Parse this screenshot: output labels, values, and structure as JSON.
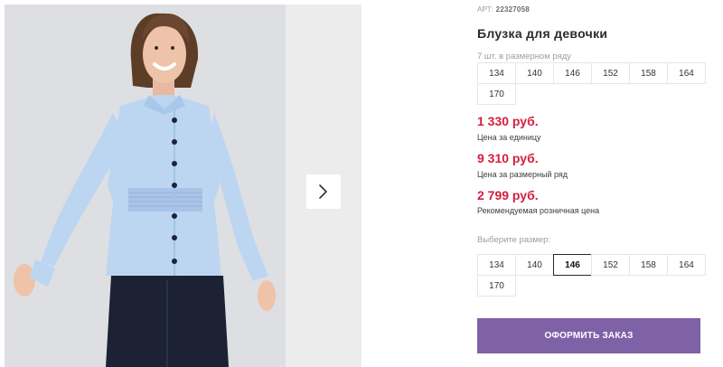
{
  "product": {
    "article_label": "АРТ:",
    "article_number": "22327058",
    "title": "Блузка для девочки",
    "photo_icon": "product-photo",
    "next_icon": "chevron-right-icon"
  },
  "size_row": {
    "label": "7 шт. в размерном ряду",
    "sizes": [
      "134",
      "140",
      "146",
      "152",
      "158",
      "164",
      "170"
    ]
  },
  "prices": [
    {
      "value": "1 330 руб.",
      "note": "Цена за единицу"
    },
    {
      "value": "9 310 руб.",
      "note": "Цена за размерный ряд"
    },
    {
      "value": "2 799 руб.",
      "note": "Рекомендуемая розничная цена"
    }
  ],
  "size_select": {
    "label": "Выберите размер:",
    "sizes": [
      "134",
      "140",
      "146",
      "152",
      "158",
      "164",
      "170"
    ],
    "selected": "146"
  },
  "order_button": "ОФОРМИТЬ ЗАКАЗ",
  "colors": {
    "price": "#d31f3c",
    "button": "#7f61a8",
    "shirt": "#bcd6f2",
    "trousers": "#1c2234"
  }
}
